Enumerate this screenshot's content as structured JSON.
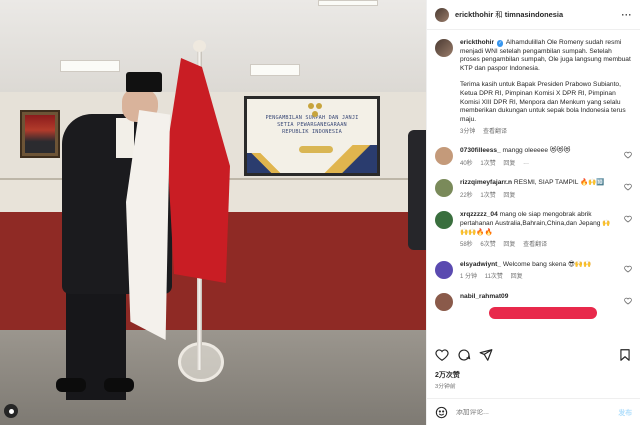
{
  "header": {
    "account": "erickthohir",
    "amp": "和",
    "collab": "timnasindonesia"
  },
  "caption": {
    "username": "erickthohir",
    "verified_glyph": "✓",
    "line1": "Alhamdulillah Ole Romeny sudah resmi menjadi WNI setelah pengambilan sumpah. Setelah proses pengambilan sumpah, Ole juga langsung membuat KTP dan paspor Indonesia.",
    "line2": "Terima kasih untuk Bapak Presiden Prabowo Subianto, Ketua DPR RI, Pimpinan Komisi X DPR RI, Pimpinan Komisi XIII DPR RI, Menpora dan Menkum yang selalu memberikan dukungan untuk sepak bola Indonesia terus maju.",
    "time": "3分钟",
    "translate": "查看翻译"
  },
  "comments": [
    {
      "user": "0730filleess_",
      "text": "mangg oleeeee",
      "emoji": "😻😻😻",
      "time": "40秒",
      "likes": "1次赞",
      "reply": "回复",
      "extra": "···",
      "avatar_color": "#c49a7a"
    },
    {
      "user": "rizzqimeyfajarr.n",
      "text": "RESMI, SIAP TAMPIL",
      "emoji": "🔥🙌🔟",
      "time": "22秒",
      "likes": "1次赞",
      "reply": "回复",
      "extra": "",
      "avatar_color": "#7a8a5a"
    },
    {
      "user": "xrqzzzzz_04",
      "text": "mang ole siap mengobrak abrik pertahanan Australia,Bahrain,China,dan Jepang",
      "emoji": "🙌🙌🙌🔥🔥",
      "time": "58秒",
      "likes": "6次赞",
      "reply": "回复",
      "extra": "查看翻译",
      "avatar_color": "#3a6f3e"
    },
    {
      "user": "elsyadwiynt_",
      "text": "Welcome bang skena",
      "emoji": "😎🙌🙌",
      "time": "1 分钟",
      "likes": "11次赞",
      "reply": "回复",
      "extra": "",
      "avatar_color": "#5a4ab0"
    },
    {
      "user": "nabil_rahmat09",
      "text": "",
      "emoji": "",
      "time": "",
      "likes": "",
      "reply": "",
      "extra": "",
      "avatar_color": "#8a5a4a"
    }
  ],
  "stats": {
    "likes": "2万次赞",
    "posted": "3分钟前"
  },
  "composer": {
    "placeholder": "添加评论...",
    "post": "发布"
  },
  "screen": {
    "line1": "PENGAMBILAN SUMPAH DAN JANJI",
    "line2": "SETIA PEWARGANEGARAAN",
    "line3": "REPUBLIK INDONESIA"
  },
  "colors": {
    "verified": "#3897f0",
    "flag_red": "#c91d24",
    "carpet": "#8f2a25",
    "post_btn": "#b2dffc"
  },
  "icons": [
    "heart-icon",
    "comment-icon",
    "share-icon",
    "bookmark-icon",
    "emoji-icon",
    "more-icon",
    "verified-icon"
  ]
}
